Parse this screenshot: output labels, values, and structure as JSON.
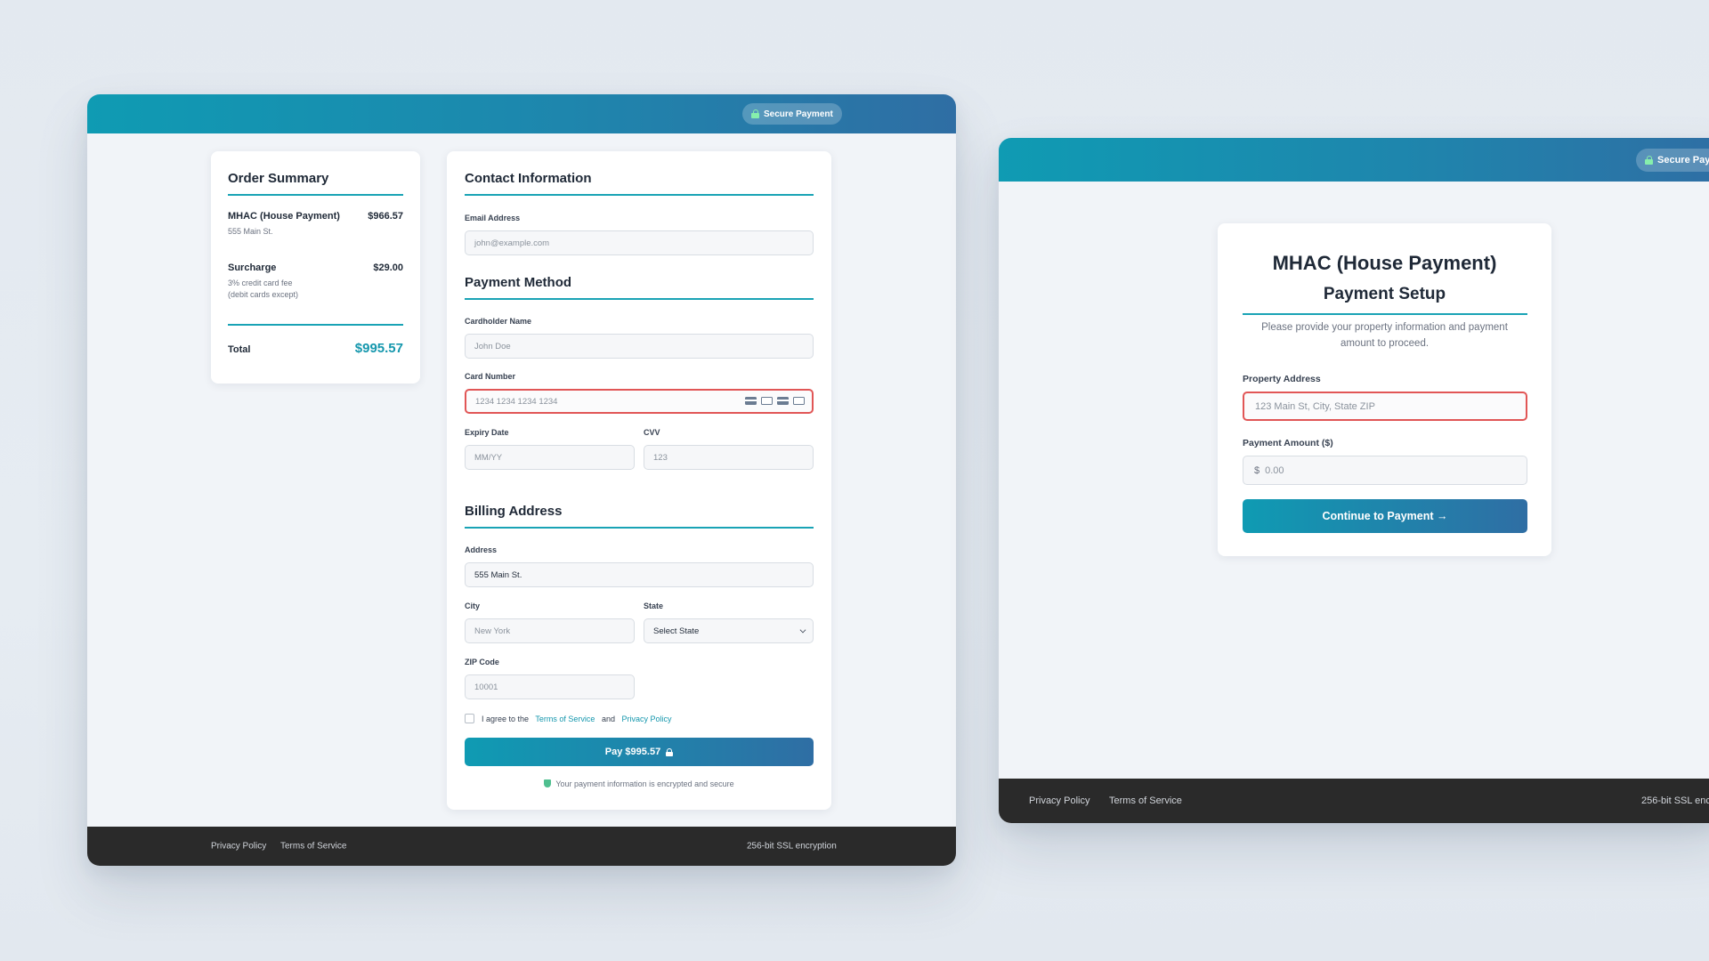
{
  "left_window": {
    "secure_badge": "Secure Payment",
    "order_summary": {
      "title": "Order Summary",
      "items": [
        {
          "name": "MHAC (House Payment)",
          "amount": "$966.57",
          "note1": "555 Main St.",
          "note2": ""
        },
        {
          "name": "Surcharge",
          "amount": "$29.00",
          "note1": "3% credit card fee",
          "note2": "(debit cards except)"
        }
      ],
      "total_label": "Total",
      "total_value": "$995.57"
    },
    "contact": {
      "title": "Contact Information",
      "email_label": "Email Address",
      "email_placeholder": "john@example.com"
    },
    "payment": {
      "title": "Payment Method",
      "cardholder_label": "Cardholder Name",
      "cardholder_placeholder": "John Doe",
      "card_label": "Card Number",
      "card_placeholder": "1234 1234 1234 1234",
      "expiry_label": "Expiry Date",
      "expiry_placeholder": "MM/YY",
      "cvv_label": "CVV",
      "cvv_placeholder": "123"
    },
    "billing": {
      "title": "Billing Address",
      "address_label": "Address",
      "address_value": "555 Main St.",
      "city_label": "City",
      "city_placeholder": "New York",
      "state_label": "State",
      "state_value": "Select State",
      "zip_label": "ZIP Code",
      "zip_placeholder": "10001"
    },
    "agree": {
      "prefix": "I agree to the",
      "terms": "Terms of Service",
      "and": "and",
      "privacy": "Privacy Policy"
    },
    "pay_button": "Pay $995.57",
    "secure_note": "Your payment information is encrypted and secure",
    "footer": {
      "privacy": "Privacy Policy",
      "terms": "Terms of Service",
      "ssl": "256-bit SSL encryption"
    }
  },
  "right_window": {
    "secure_badge": "Secure Pay",
    "title": "MHAC (House Payment)",
    "subtitle": "Payment Setup",
    "description_line1": "Please provide your property information and payment",
    "description_line2": "amount to proceed.",
    "property_label": "Property Address",
    "property_placeholder": "123 Main St, City, State ZIP",
    "amount_label": "Payment Amount ($)",
    "amount_prefix": "$",
    "amount_placeholder": "0.00",
    "continue_button": "Continue to Payment →",
    "footer": {
      "privacy": "Privacy Policy",
      "terms": "Terms of Service",
      "ssl": "256-bit SSL enc"
    }
  }
}
